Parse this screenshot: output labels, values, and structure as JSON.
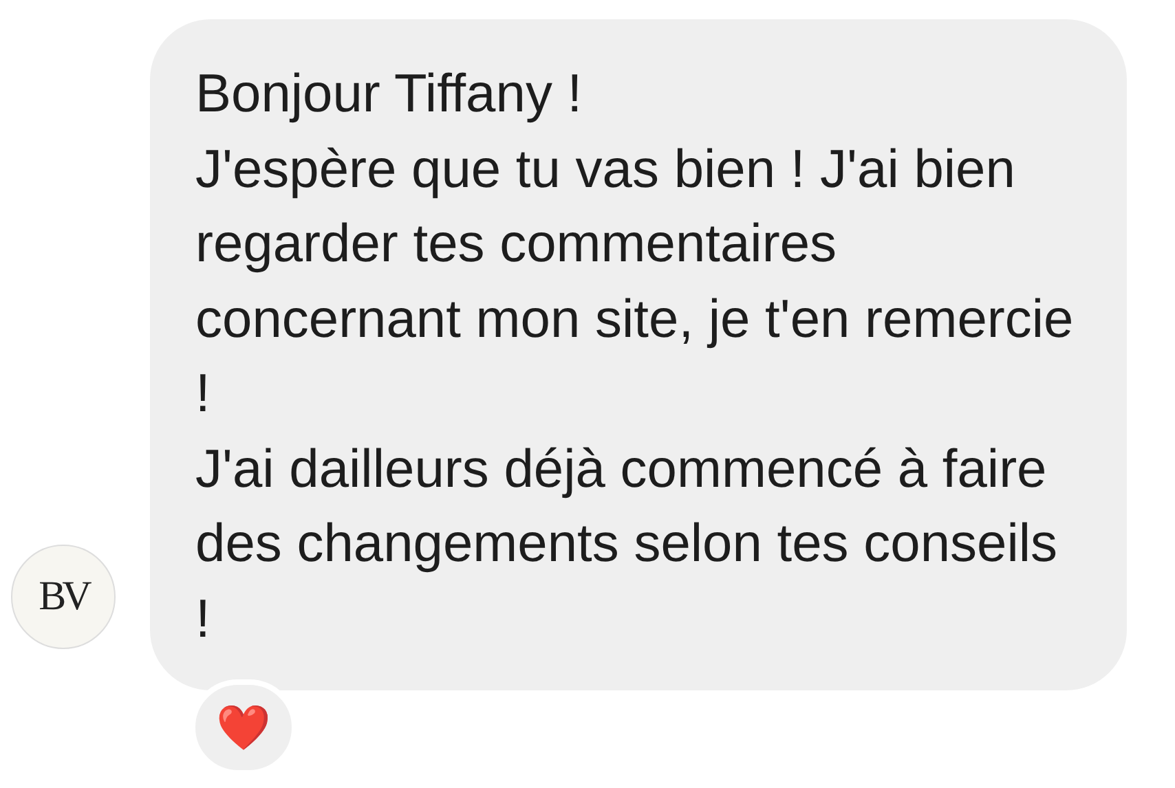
{
  "message": {
    "paragraphs": [
      "Bonjour Tiffany !",
      "J'espère que tu vas bien ! J'ai bien regarder tes commentaires concernant mon site, je t'en remercie !",
      "J'ai dailleurs déjà commencé à faire des changements selon tes conseils !"
    ],
    "sender_avatar": {
      "logo_text": "BV"
    },
    "reaction": "❤️"
  }
}
